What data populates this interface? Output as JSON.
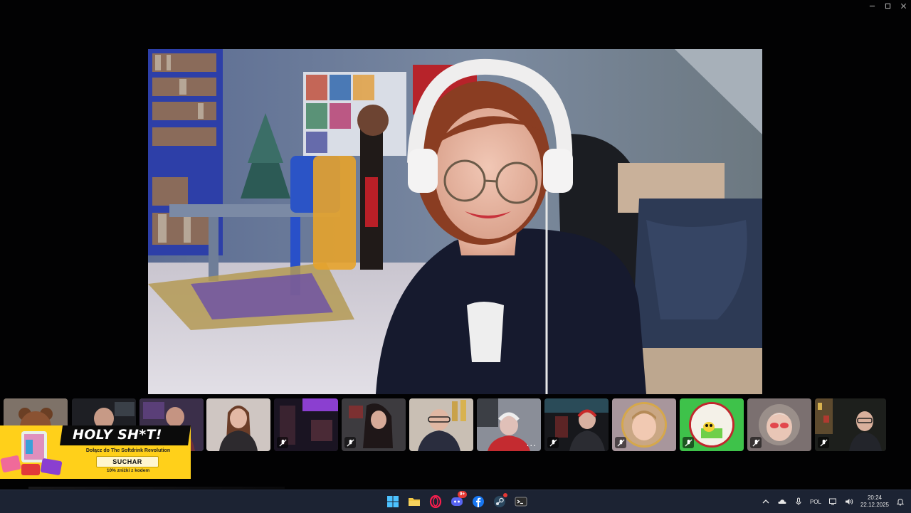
{
  "window": {
    "controls": [
      "minimize-icon",
      "maximize-icon",
      "close-icon"
    ]
  },
  "main_video": {
    "description_icon": "webcam-feed"
  },
  "participants": [
    {
      "id": "p1",
      "muted": false,
      "kind": "avatar-bear"
    },
    {
      "id": "p2",
      "muted": false,
      "kind": "camera"
    },
    {
      "id": "p3",
      "muted": false,
      "kind": "camera",
      "highlighted": true
    },
    {
      "id": "p4",
      "muted": false,
      "kind": "camera"
    },
    {
      "id": "p5",
      "muted": true,
      "kind": "camera"
    },
    {
      "id": "p6",
      "muted": true,
      "kind": "camera"
    },
    {
      "id": "p7",
      "muted": false,
      "kind": "camera"
    },
    {
      "id": "p8",
      "muted": false,
      "kind": "camera",
      "more_label": "..."
    },
    {
      "id": "p9",
      "muted": true,
      "kind": "camera"
    },
    {
      "id": "p10",
      "muted": true,
      "kind": "avatar-child",
      "bg": "#a8969c"
    },
    {
      "id": "p11",
      "muted": true,
      "kind": "avatar-cartoon",
      "bg": "#3ec24a"
    },
    {
      "id": "p12",
      "muted": true,
      "kind": "avatar-elder",
      "bg": "#7b7070"
    },
    {
      "id": "p13",
      "muted": true,
      "kind": "camera"
    }
  ],
  "ad": {
    "title": "HOLY SH*T!",
    "subtitle": "Dołącz do The Softdrink Revolution",
    "code": "SUCHAR",
    "discount": "10% zniżki z kodem",
    "accent": "#ffd01a"
  },
  "taskbar": {
    "apps": [
      {
        "name": "start-button",
        "icon": "windows-icon"
      },
      {
        "name": "file-explorer",
        "icon": "folder-icon"
      },
      {
        "name": "opera-gx",
        "icon": "opera-icon"
      },
      {
        "name": "discord",
        "icon": "discord-icon",
        "badge": "9+"
      },
      {
        "name": "facebook",
        "icon": "facebook-icon"
      },
      {
        "name": "steam",
        "icon": "steam-icon",
        "dot": true
      },
      {
        "name": "terminal",
        "icon": "terminal-icon"
      }
    ],
    "tray": {
      "language": "POL",
      "time": "20:24",
      "date": "22.12.2025"
    }
  }
}
